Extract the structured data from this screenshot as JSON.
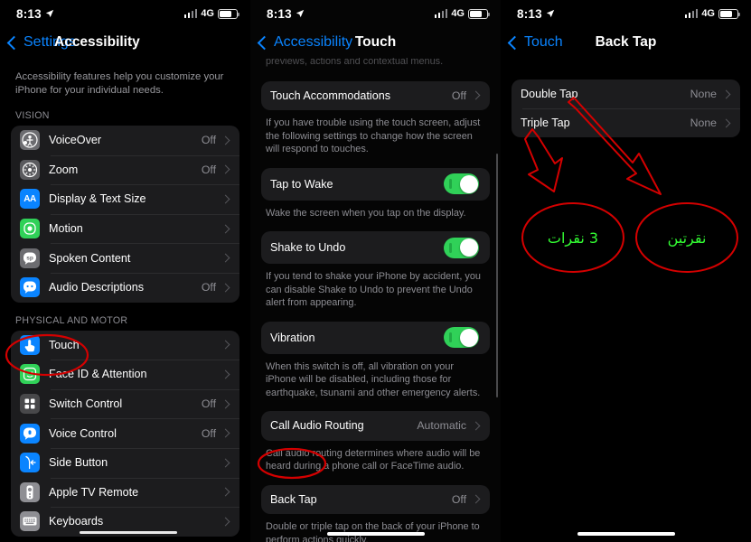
{
  "statusbar": {
    "time": "8:13",
    "network": "4G",
    "location_icon": "location-arrow-icon",
    "signal_icon": "cellular-bars-icon",
    "battery_icon": "battery-icon"
  },
  "screen1": {
    "back_label": "Settings",
    "title": "Accessibility",
    "blurb": "Accessibility features help you customize your iPhone for your individual needs.",
    "sections": [
      {
        "header": "VISION",
        "rows": [
          {
            "label": "VoiceOver",
            "value": "Off",
            "icon": "voiceover-icon",
            "icon_color": "#6c6c70"
          },
          {
            "label": "Zoom",
            "value": "Off",
            "icon": "zoom-icon",
            "icon_color": "#5a5a5e"
          },
          {
            "label": "Display & Text Size",
            "value": "",
            "icon": "display-text-size-icon",
            "icon_color": "#0a84ff"
          },
          {
            "label": "Motion",
            "value": "",
            "icon": "motion-icon",
            "icon_color": "#30d158"
          },
          {
            "label": "Spoken Content",
            "value": "",
            "icon": "spoken-content-icon",
            "icon_color": "#6c6c70"
          },
          {
            "label": "Audio Descriptions",
            "value": "Off",
            "icon": "audio-descriptions-icon",
            "icon_color": "#0a84ff"
          }
        ]
      },
      {
        "header": "PHYSICAL AND MOTOR",
        "rows": [
          {
            "label": "Touch",
            "value": "",
            "icon": "touch-icon",
            "icon_color": "#0a84ff"
          },
          {
            "label": "Face ID & Attention",
            "value": "",
            "icon": "face-id-icon",
            "icon_color": "#30d158"
          },
          {
            "label": "Switch Control",
            "value": "Off",
            "icon": "switch-control-icon",
            "icon_color": "#48484a"
          },
          {
            "label": "Voice Control",
            "value": "Off",
            "icon": "voice-control-icon",
            "icon_color": "#0a84ff"
          },
          {
            "label": "Side Button",
            "value": "",
            "icon": "side-button-icon",
            "icon_color": "#0a84ff"
          },
          {
            "label": "Apple TV Remote",
            "value": "",
            "icon": "apple-tv-remote-icon",
            "icon_color": "#8e8e93"
          },
          {
            "label": "Keyboards",
            "value": "",
            "icon": "keyboards-icon",
            "icon_color": "#8e8e93"
          }
        ]
      }
    ]
  },
  "screen2": {
    "back_label": "Accessibility",
    "title": "Touch",
    "top_partial_text": "previews, actions and contextual menus.",
    "items": [
      {
        "kind": "link",
        "label": "Touch Accommodations",
        "value": "Off",
        "footer": "If you have trouble using the touch screen, adjust the following settings to change how the screen will respond to touches."
      },
      {
        "kind": "toggle",
        "label": "Tap to Wake",
        "toggle_on": true,
        "footer": "Wake the screen when you tap on the display."
      },
      {
        "kind": "toggle",
        "label": "Shake to Undo",
        "toggle_on": true,
        "footer": "If you tend to shake your iPhone by accident, you can disable Shake to Undo to prevent the Undo alert from appearing."
      },
      {
        "kind": "toggle",
        "label": "Vibration",
        "toggle_on": true,
        "footer": "When this switch is off, all vibration on your iPhone will be disabled, including those for earthquake, tsunami and other emergency alerts."
      },
      {
        "kind": "link",
        "label": "Call Audio Routing",
        "value": "Automatic",
        "footer": "Call audio routing determines where audio will be heard during a phone call or FaceTime audio."
      },
      {
        "kind": "link",
        "label": "Back Tap",
        "value": "Off",
        "footer": "Double or triple tap on the back of your iPhone to perform actions quickly."
      }
    ]
  },
  "screen3": {
    "back_label": "Touch",
    "title": "Back Tap",
    "rows": [
      {
        "label": "Double Tap",
        "value": "None"
      },
      {
        "label": "Triple Tap",
        "value": "None"
      }
    ]
  },
  "annotations": {
    "circle_color": "#d40000",
    "text_color": "#33ff33",
    "left_circle_text": "3 نقرات",
    "right_circle_text": "نقرتين",
    "highlighted_rows": [
      "Touch",
      "Back Tap"
    ]
  }
}
